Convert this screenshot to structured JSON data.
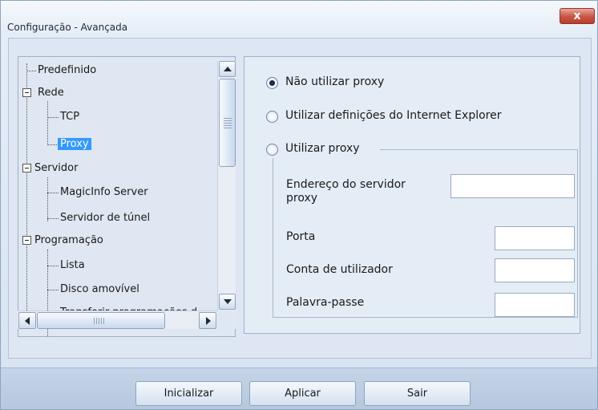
{
  "window": {
    "title": "Configuração - Avançada",
    "close_label": "x"
  },
  "tree": {
    "items": [
      {
        "label": "Predefinido"
      },
      {
        "label": "Rede"
      },
      {
        "label": "TCP"
      },
      {
        "label": "Proxy",
        "selected": true
      },
      {
        "label": "Servidor"
      },
      {
        "label": "MagicInfo Server"
      },
      {
        "label": "Servidor de túnel"
      },
      {
        "label": "Programação"
      },
      {
        "label": "Lista"
      },
      {
        "label": "Disco amovível"
      },
      {
        "label": "Transferir programações d"
      }
    ]
  },
  "proxy": {
    "options": [
      {
        "label": "Não utilizar proxy",
        "checked": true
      },
      {
        "label": "Utilizar definições do Internet Explorer",
        "checked": false
      },
      {
        "label": "Utilizar proxy",
        "checked": false
      }
    ],
    "fields": {
      "server_address": {
        "label": "Endereço do servidor proxy",
        "value": ""
      },
      "port": {
        "label": "Porta",
        "value": ""
      },
      "user_account": {
        "label": "Conta de utilizador",
        "value": ""
      },
      "password": {
        "label": "Palavra-passe",
        "value": ""
      }
    }
  },
  "buttons": {
    "reset": "Inicializar",
    "apply": "Aplicar",
    "exit": "Sair"
  },
  "colors": {
    "selection": "#3399ff",
    "close_button": "#c85442"
  }
}
